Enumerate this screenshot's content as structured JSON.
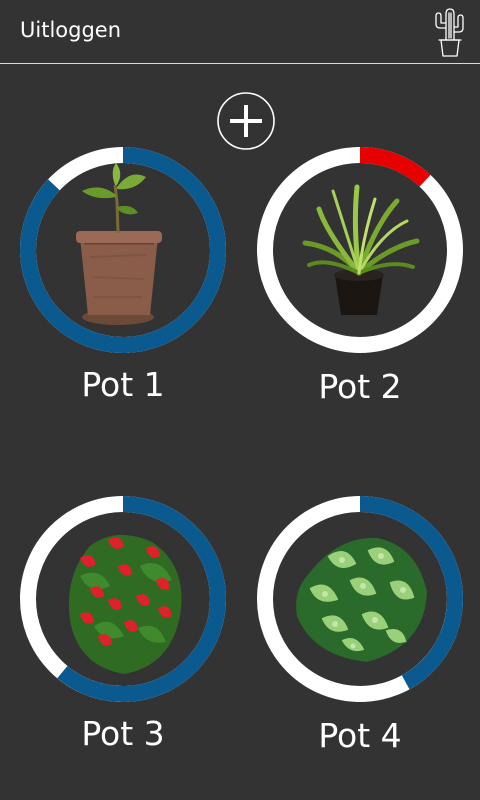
{
  "header": {
    "logout_label": "Uitloggen",
    "logo_icon": "cactus-pot-icon"
  },
  "actions": {
    "add_icon": "plus-circle-icon"
  },
  "colors": {
    "background": "#333333",
    "ring_track": "#ffffff",
    "ring_level": "#0b5a8f",
    "ring_alert": "#e60000"
  },
  "pots": [
    {
      "label": "Pot 1",
      "plant": "fig-in-clay-pot",
      "level_fraction": 0.87,
      "status": "ok"
    },
    {
      "label": "Pot 2",
      "plant": "dracaena-in-black-pot",
      "level_fraction": 0.12,
      "status": "alert"
    },
    {
      "label": "Pot 3",
      "plant": "red-anthurium",
      "level_fraction": 0.61,
      "status": "ok"
    },
    {
      "label": "Pot 4",
      "plant": "dieffenbachia",
      "level_fraction": 0.42,
      "status": "ok"
    }
  ]
}
